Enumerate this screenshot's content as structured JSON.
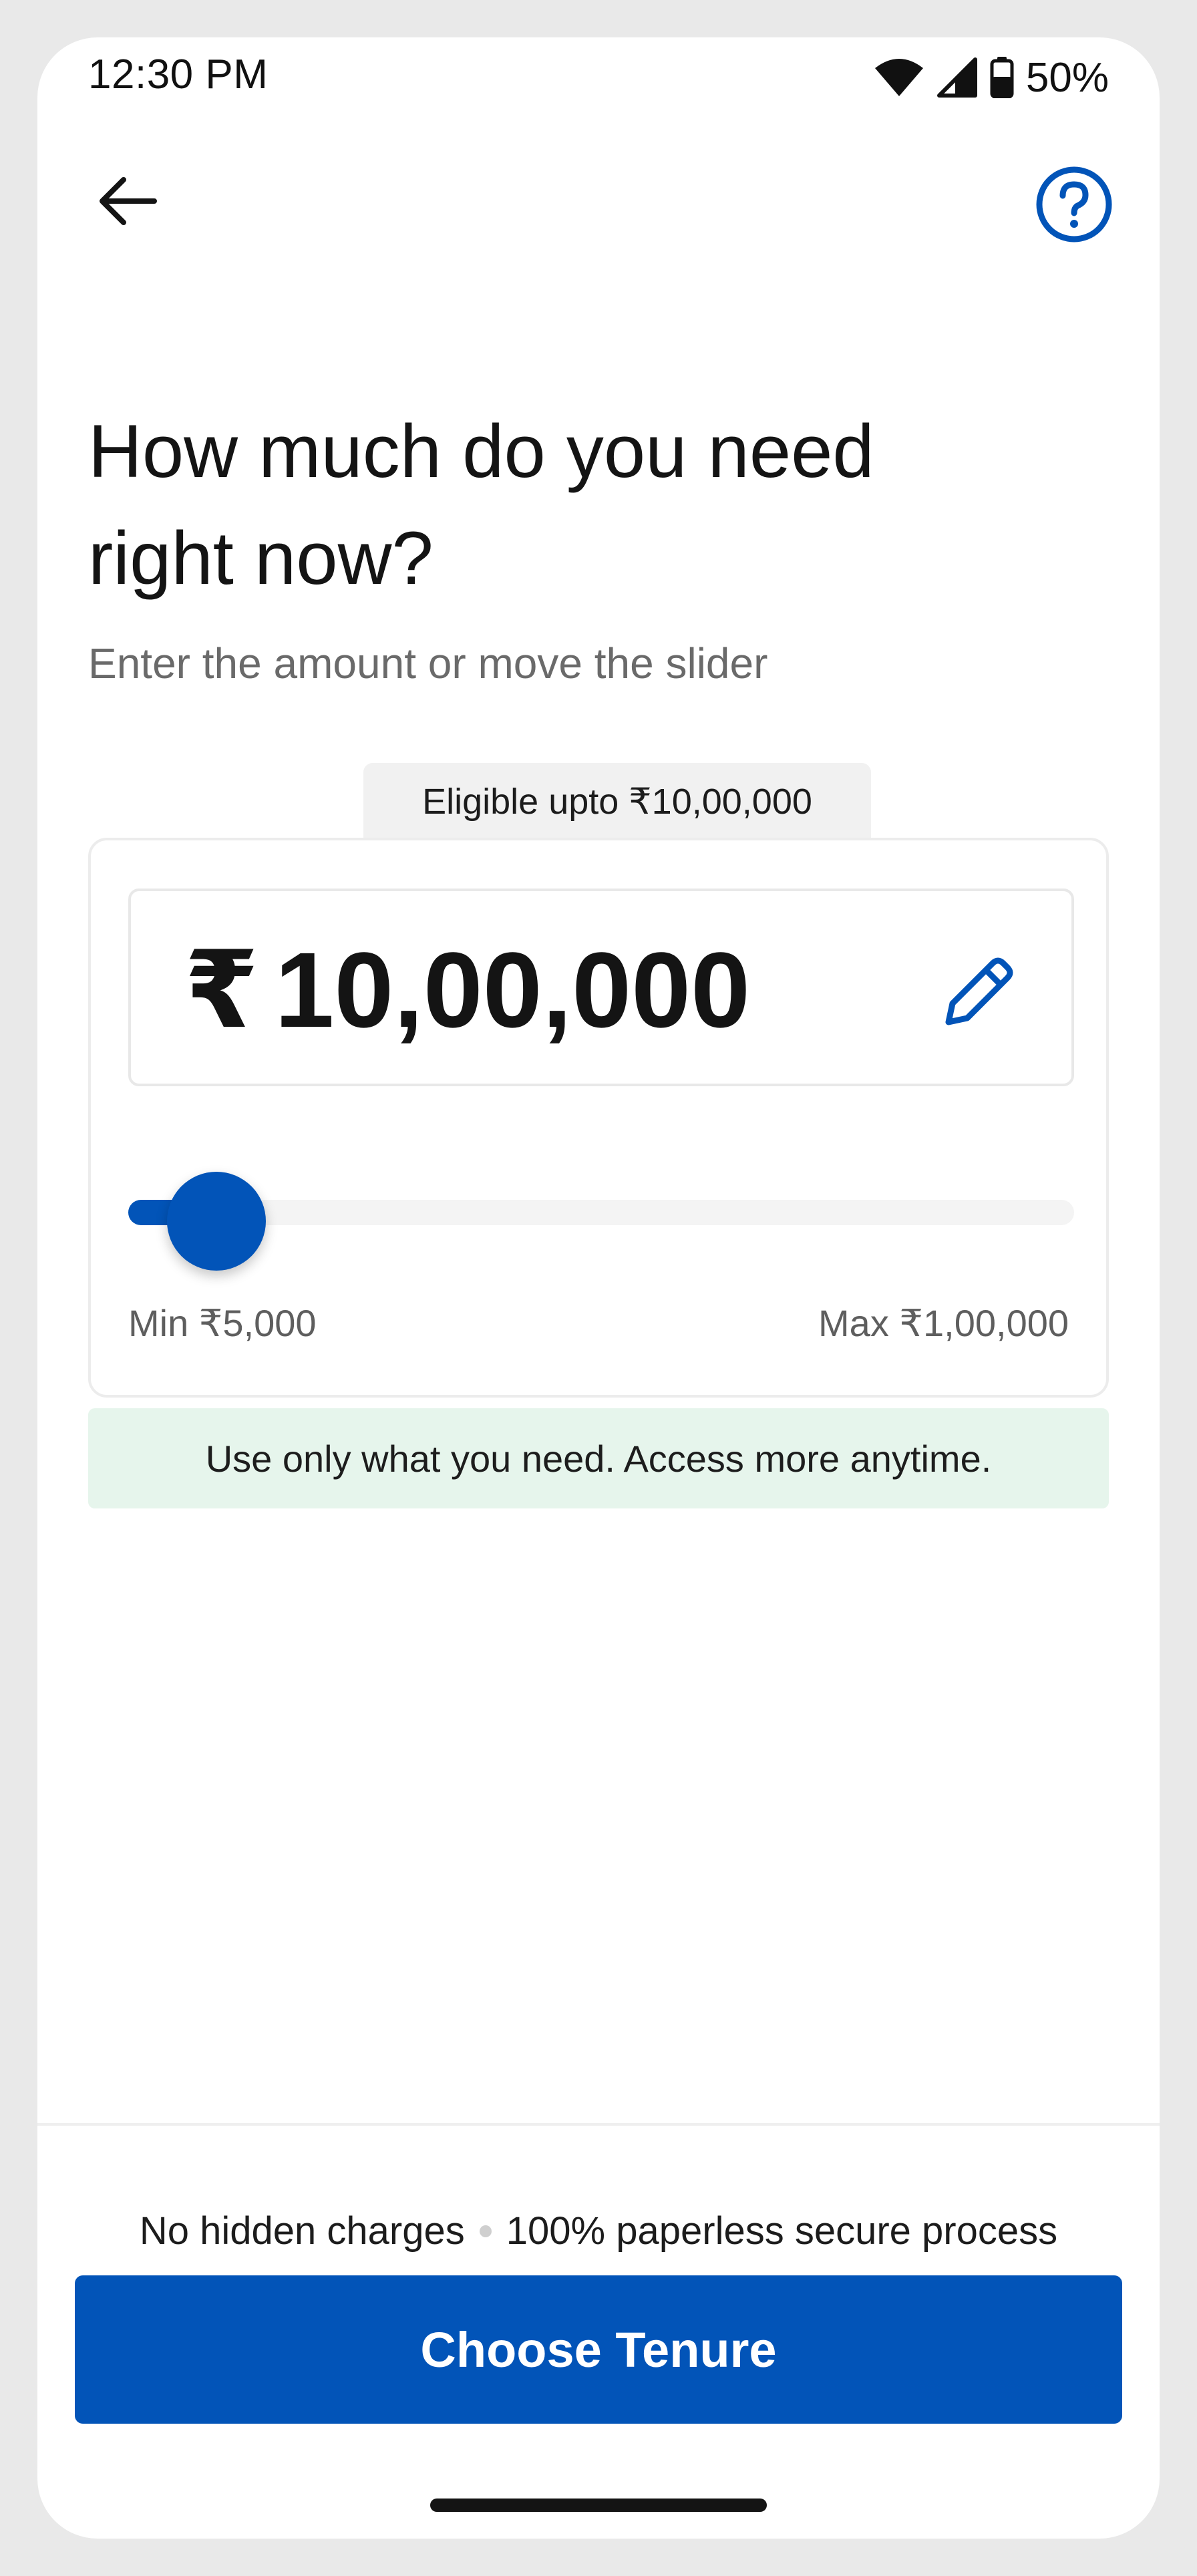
{
  "status_bar": {
    "time": "12:30 PM",
    "battery_percent": "50%",
    "icons": [
      "wifi-icon",
      "cellular-signal-icon",
      "battery-icon"
    ]
  },
  "header": {
    "back_icon": "arrow-left-icon",
    "help_icon": "question-circle-icon"
  },
  "title": "How much do you need right now?",
  "subtitle": "Enter the amount or move the slider",
  "amount_card": {
    "eligible_label": "Eligible upto ₹10,00,000",
    "currency_symbol": "₹",
    "amount": "10,00,000",
    "edit_icon": "pencil-icon",
    "slider": {
      "min_label": "Min ₹5,000",
      "max_label": "Max ₹1,00,000",
      "value_fraction": 0.0
    }
  },
  "info_banner": "Use only what you need. Access more anytime.",
  "footer": {
    "note_left": "No hidden charges",
    "note_right": "100% paperless secure process",
    "cta_label": "Choose Tenure"
  },
  "colors": {
    "primary": "#0254b8",
    "banner_bg": "#e6f5ec",
    "text": "#141414"
  }
}
